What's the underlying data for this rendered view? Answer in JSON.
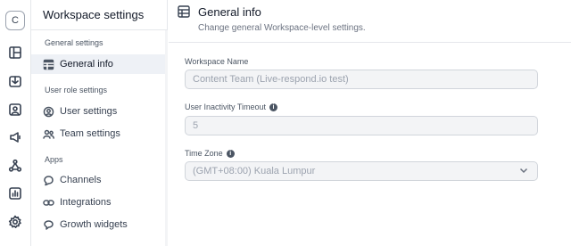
{
  "rail": {
    "avatar_letter": "C",
    "icons": [
      "dashboard-icon",
      "inbox-icon",
      "contacts-icon",
      "broadcasts-icon",
      "workflows-icon",
      "reports-icon",
      "settings-icon"
    ]
  },
  "sidebar": {
    "title": "Workspace settings",
    "sections": [
      {
        "label": "General settings",
        "items": [
          {
            "label": "General info",
            "icon": "table-icon",
            "active": true
          }
        ]
      },
      {
        "label": "User role settings",
        "items": [
          {
            "label": "User settings",
            "icon": "user-gear-icon"
          },
          {
            "label": "Team settings",
            "icon": "users-icon"
          }
        ]
      },
      {
        "label": "Apps",
        "items": [
          {
            "label": "Channels",
            "icon": "chat-icon"
          },
          {
            "label": "Integrations",
            "icon": "link-icon"
          },
          {
            "label": "Growth widgets",
            "icon": "widget-icon"
          }
        ]
      }
    ]
  },
  "main": {
    "title": "General info",
    "subtitle": "Change general Workspace-level settings.",
    "fields": {
      "workspace_name": {
        "label": "Workspace Name",
        "value": "Content Team (Live-respond.io test)"
      },
      "inactivity_timeout": {
        "label": "User Inactivity Timeout",
        "value": "5",
        "info_icon": "info-icon"
      },
      "time_zone": {
        "label": "Time Zone",
        "value": "(GMT+08:00) Kuala Lumpur",
        "info_icon": "info-icon"
      }
    }
  },
  "colors": {
    "active_bg": "#eef1f6",
    "border": "#e5e7eb",
    "field_bg": "#f3f4f6",
    "muted_text": "#9ca3af"
  }
}
